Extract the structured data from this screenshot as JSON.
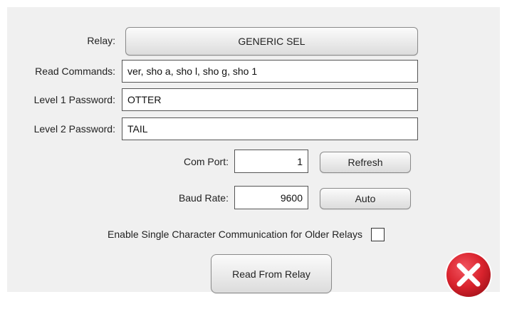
{
  "form": {
    "relay": {
      "label": "Relay:",
      "button": "GENERIC SEL"
    },
    "read_commands": {
      "label": "Read Commands:",
      "value": "ver, sho a, sho l, sho g, sho 1"
    },
    "level1_password": {
      "label": "Level 1 Password:",
      "value": "OTTER"
    },
    "level2_password": {
      "label": "Level 2 Password:",
      "value": "TAIL"
    },
    "com_port": {
      "label": "Com Port:",
      "value": "1",
      "button": "Refresh"
    },
    "baud_rate": {
      "label": "Baud Rate:",
      "value": "9600",
      "button": "Auto"
    },
    "single_char": {
      "label": "Enable Single Character Communication for Older Relays",
      "checked": false
    },
    "read_button": "Read From Relay"
  },
  "icons": {
    "close": "close-icon"
  },
  "colors": {
    "panel_bg": "#f0f0f0",
    "close_red": "#d9232d"
  }
}
